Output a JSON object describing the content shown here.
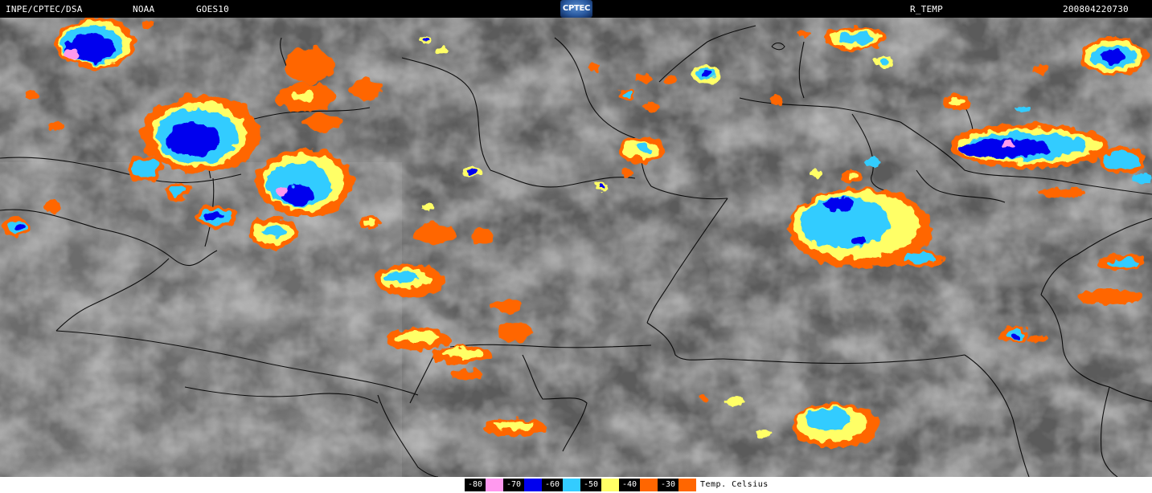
{
  "header": {
    "source": "INPE/CPTEC/DSA",
    "agency": "NOAA",
    "satellite": "GOES10",
    "logo_text": "CPTEC",
    "product": "R_TEMP",
    "timestamp": "200804220730"
  },
  "legend": {
    "title": "Temp. Celsius",
    "entries": [
      {
        "label": "-80",
        "color": "#ff99ee"
      },
      {
        "label": "-70",
        "color": "#0000ee"
      },
      {
        "label": "-60",
        "color": "#33ccff"
      },
      {
        "label": "-50",
        "color": "#ffff66"
      },
      {
        "label": "-40",
        "color": "#ff6600"
      },
      {
        "label": "-30",
        "color": "#ff6600"
      }
    ]
  },
  "palette": {
    "cloud_cold_1": "#ff6600",
    "cloud_cold_2": "#ffff66",
    "cloud_cold_3": "#33ccff",
    "cloud_cold_4": "#0000ee",
    "cloud_cold_5": "#ff99ee",
    "background_gray": "#5a5a5a",
    "border_lines": "#000000"
  }
}
